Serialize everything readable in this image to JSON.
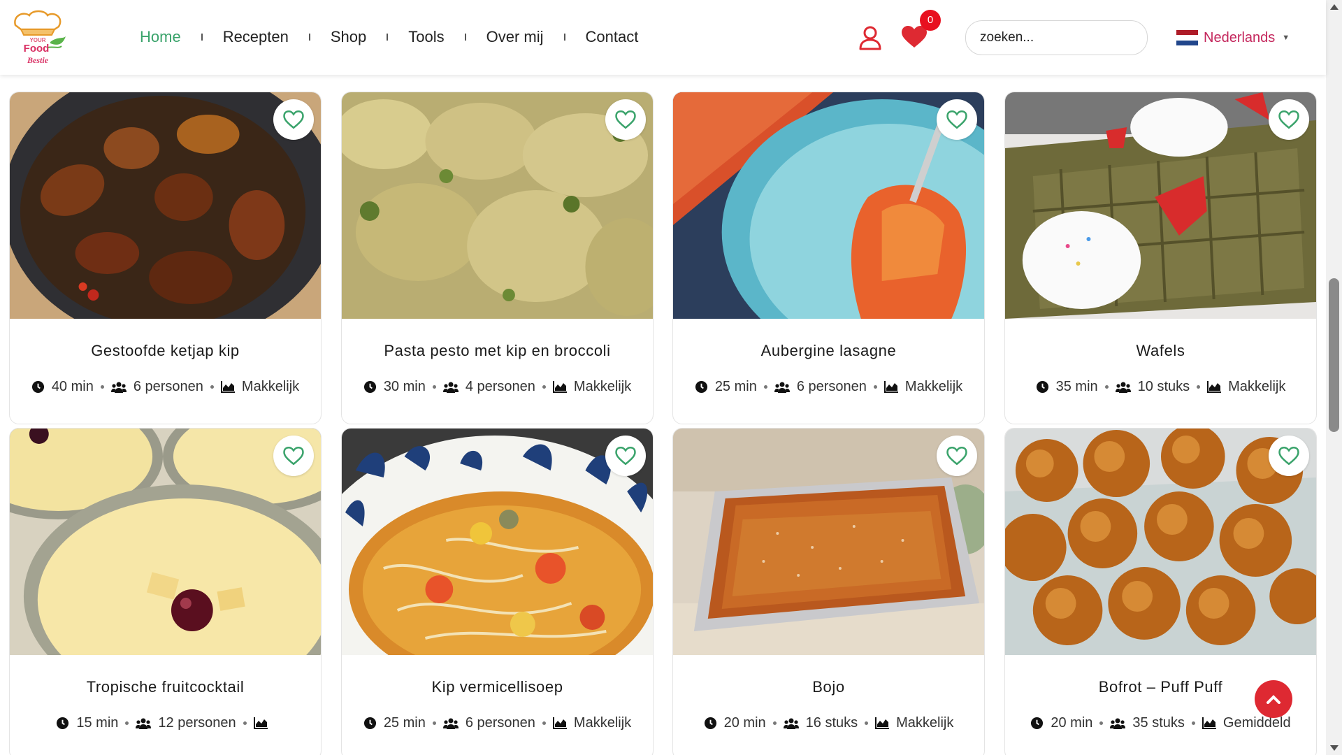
{
  "logo": {
    "line1": "YOUR",
    "line2": "Food",
    "line3": "Bestie"
  },
  "nav": [
    {
      "label": "Home",
      "active": true
    },
    {
      "label": "Recepten",
      "active": false
    },
    {
      "label": "Shop",
      "active": false
    },
    {
      "label": "Tools",
      "active": false
    },
    {
      "label": "Over mij",
      "active": false
    },
    {
      "label": "Contact",
      "active": false
    }
  ],
  "favorites_count": "0",
  "search": {
    "placeholder": "zoeken..."
  },
  "language": {
    "label": "Nederlands",
    "flag_colors": [
      "#ae1c28",
      "#ffffff",
      "#21468b"
    ]
  },
  "colors": {
    "accent_green": "#3aa36b",
    "badge_red": "#e8101f",
    "language_pink": "#c4265c",
    "back_to_top": "#de2932"
  },
  "recipes": [
    {
      "title": "Gestoofde ketjap kip",
      "time": "40 min",
      "servings": "6 personen",
      "difficulty": "Makkelijk"
    },
    {
      "title": "Pasta pesto met kip en broccoli",
      "time": "30 min",
      "servings": "4 personen",
      "difficulty": "Makkelijk"
    },
    {
      "title": "Aubergine lasagne",
      "time": "25 min",
      "servings": "6 personen",
      "difficulty": "Makkelijk"
    },
    {
      "title": "Wafels",
      "time": "35 min",
      "servings": "10 stuks",
      "difficulty": "Makkelijk"
    },
    {
      "title": "Tropische fruitcocktail",
      "time": "15 min",
      "servings": "12 personen",
      "difficulty": ""
    },
    {
      "title": "Kip vermicellisoep",
      "time": "25 min",
      "servings": "6 personen",
      "difficulty": "Makkelijk"
    },
    {
      "title": "Bojo",
      "time": "20 min",
      "servings": "16 stuks",
      "difficulty": "Makkelijk"
    },
    {
      "title": "Bofrot – Puff Puff",
      "time": "20 min",
      "servings": "35 stuks",
      "difficulty": "Gemiddeld"
    }
  ]
}
